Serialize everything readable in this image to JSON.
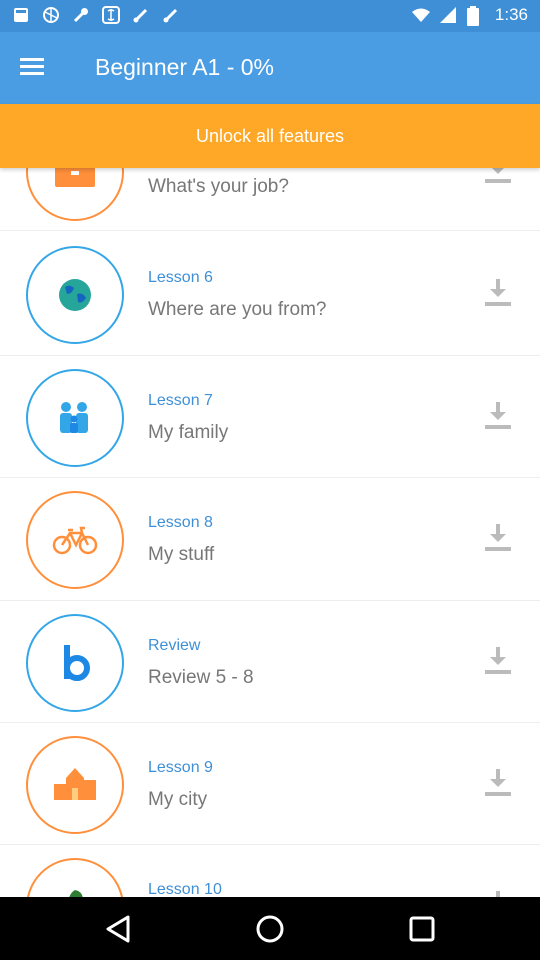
{
  "status_bar": {
    "time": "1:36",
    "left_icons": [
      "app-notification-icon",
      "sports-icon",
      "wrench-icon",
      "currency-icon",
      "brush-icon",
      "brush-icon"
    ],
    "right_icons": [
      "wifi-icon",
      "signal-icon",
      "battery-icon"
    ]
  },
  "app_bar": {
    "title": "Beginner A1 - 0%",
    "menu_icon": "hamburger-menu-icon"
  },
  "promo": {
    "label": "Unlock all features"
  },
  "lessons": [
    {
      "title": "",
      "subtitle": "What's your job?",
      "icon": "briefcase-icon",
      "accent": "#ff8f3a"
    },
    {
      "title": "Lesson 6",
      "subtitle": "Where are you from?",
      "icon": "globe-icon",
      "accent": "#33a6e8"
    },
    {
      "title": "Lesson 7",
      "subtitle": "My family",
      "icon": "family-icon",
      "accent": "#33a6e8"
    },
    {
      "title": "Lesson 8",
      "subtitle": "My stuff",
      "icon": "bicycle-icon",
      "accent": "#ff8f3a"
    },
    {
      "title": "Review",
      "subtitle": "Review 5 - 8",
      "icon": "letter-b-icon",
      "accent": "#33a6e8"
    },
    {
      "title": "Lesson 9",
      "subtitle": "My city",
      "icon": "city-icon",
      "accent": "#ff8f3a"
    },
    {
      "title": "Lesson 10",
      "subtitle": "",
      "icon": "leaf-icon",
      "accent": "#ff8f3a"
    }
  ],
  "download_icon": "download-icon",
  "nav_bar": {
    "buttons": [
      "back-icon",
      "home-icon",
      "recents-icon"
    ]
  },
  "colors": {
    "status_bar": "#3f8fd6",
    "app_bar": "#4a9de2",
    "promo": "#ffa726",
    "lesson_title": "#3f8fd6",
    "subtitle": "#777777",
    "blue_accent": "#33a6e8",
    "orange_accent": "#ff8f3a"
  }
}
